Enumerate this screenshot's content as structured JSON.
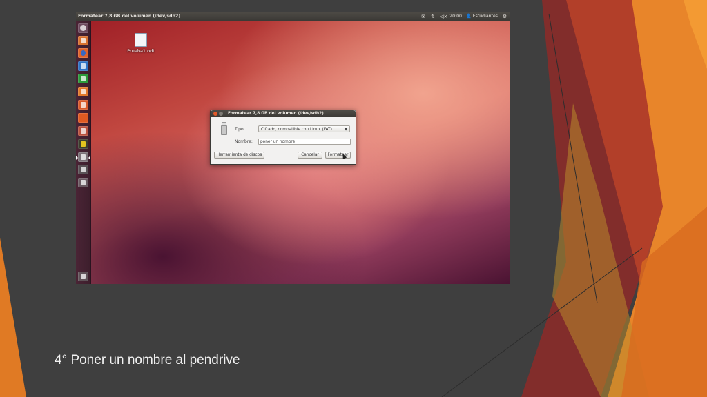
{
  "window": {
    "topbar_title": "Formatear 7,8 GB del volumen (/dev/sdb2)",
    "indicators": {
      "mail_icon": "envelope-icon",
      "network_icon": "network-arrows-icon",
      "volume_icon": "speaker-muted-icon",
      "time": "20:00",
      "user_icon": "user-icon",
      "user": "Estudiantes",
      "session_icon": "gear-icon"
    }
  },
  "launcher": {
    "items": [
      "dash",
      "files",
      "firefox",
      "libreoffice-writer",
      "libreoffice-calc",
      "libreoffice-impress",
      "software-center",
      "ubuntu-one",
      "system-settings",
      "xpad",
      "disks",
      "terminal",
      "usb-drive"
    ],
    "trash": "trash"
  },
  "desktop": {
    "file_label": "Prueba1.odt",
    "file_icon": "odt-document-icon"
  },
  "dialog": {
    "title": "Formatear 7,8 GB del volumen (/dev/sdb2)",
    "type_label": "Tipo:",
    "type_value": "Cifrado, compatible con Linux (FAT)",
    "name_label": "Nombre:",
    "name_value": "poner un nombre",
    "disk_tool_button": "Herramienta de discos",
    "cancel_button": "Cancelar",
    "format_button": "Formatear"
  },
  "slide": {
    "caption": "4° Poner un nombre al pendrive",
    "accent_colors": [
      "#e8852a",
      "#c2392b",
      "#d86a1f"
    ]
  }
}
